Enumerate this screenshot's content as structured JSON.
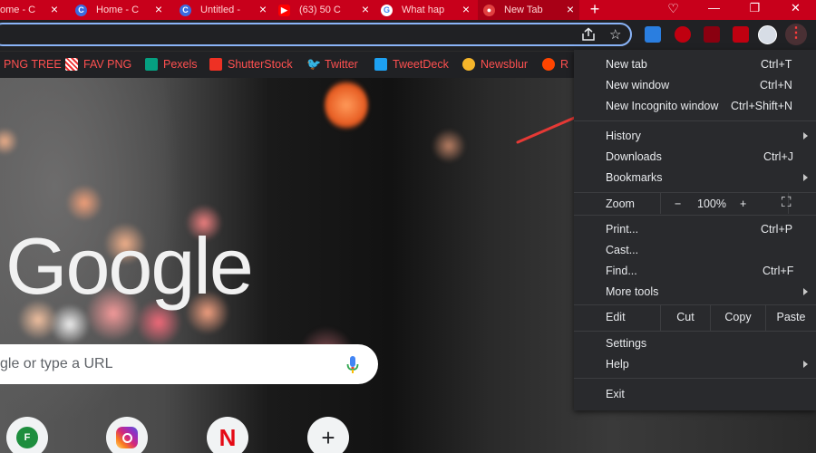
{
  "tabs": [
    {
      "title": "ome - C",
      "icon": "home-tab-icon"
    },
    {
      "title": "Home - C",
      "icon": "canva-tab-icon"
    },
    {
      "title": "Untitled -",
      "icon": "canva-tab-icon"
    },
    {
      "title": "(63) 50 C",
      "icon": "youtube-tab-icon"
    },
    {
      "title": "What hap",
      "icon": "google-tab-icon"
    },
    {
      "title": "New Tab",
      "icon": "newtab-tab-icon"
    }
  ],
  "new_tab_glyph": "+",
  "window_controls": {
    "minimize": "—",
    "maximize": "❐",
    "close": "✕"
  },
  "bookmarks": [
    {
      "label": "PNG TREE",
      "color": "#ff5050"
    },
    {
      "label": "FAV PNG",
      "color": "#ffffff"
    },
    {
      "label": "Pexels",
      "color": "#05a081"
    },
    {
      "label": "ShutterStock",
      "color": "#ee3124"
    },
    {
      "label": "Twitter",
      "color": "#1da1f2"
    },
    {
      "label": "TweetDeck",
      "color": "#1da1f2"
    },
    {
      "label": "Newsblur",
      "color": "#f5b52a"
    },
    {
      "label": "R",
      "color": "#ff4500"
    }
  ],
  "page": {
    "logo": "Google",
    "search_placeholder": "gle or type a URL",
    "shortcuts": [
      {
        "icon": "f-icon",
        "letter": "F"
      },
      {
        "icon": "instagram-icon"
      },
      {
        "icon": "netflix-icon",
        "letter": "N"
      },
      {
        "icon": "add-shortcut-icon",
        "letter": "+"
      }
    ]
  },
  "menu": {
    "new_tab": {
      "label": "New tab",
      "shortcut": "Ctrl+T"
    },
    "new_window": {
      "label": "New window",
      "shortcut": "Ctrl+N"
    },
    "new_incognito": {
      "label": "New Incognito window",
      "shortcut": "Ctrl+Shift+N"
    },
    "history": {
      "label": "History"
    },
    "downloads": {
      "label": "Downloads",
      "shortcut": "Ctrl+J"
    },
    "bookmarks": {
      "label": "Bookmarks"
    },
    "zoom": {
      "label": "Zoom",
      "minus": "−",
      "level": "100%",
      "plus": "+",
      "fullscreen": "⛶"
    },
    "print": {
      "label": "Print...",
      "shortcut": "Ctrl+P"
    },
    "cast": {
      "label": "Cast..."
    },
    "find": {
      "label": "Find...",
      "shortcut": "Ctrl+F"
    },
    "more_tools": {
      "label": "More tools"
    },
    "edit": {
      "label": "Edit",
      "cut": "Cut",
      "copy": "Copy",
      "paste": "Paste"
    },
    "settings": {
      "label": "Settings"
    },
    "help": {
      "label": "Help"
    },
    "exit": {
      "label": "Exit"
    }
  },
  "colors": {
    "accent": "#c8001b",
    "menu_bg": "#292a2d",
    "annotation_arrow": "#e53935"
  }
}
